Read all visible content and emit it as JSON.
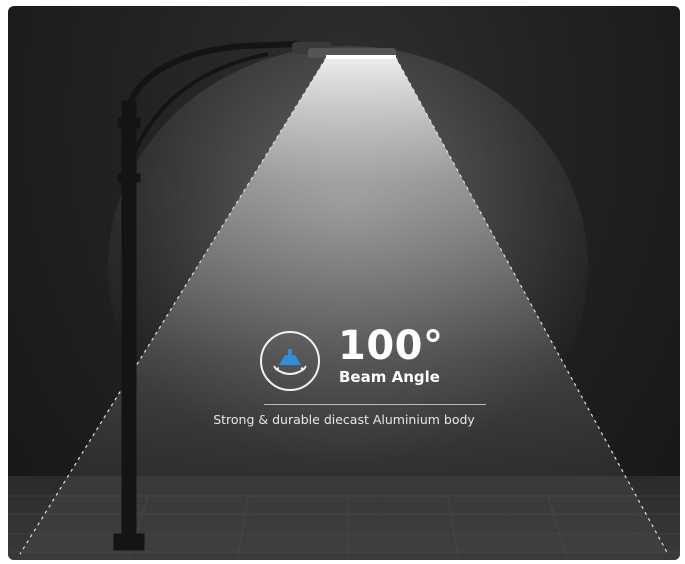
{
  "beam": {
    "angle_value": "100°",
    "angle_label": "Beam Angle",
    "caption": "Strong & durable diecast Aluminium body"
  },
  "colors": {
    "background": "#1f1f1f",
    "beam_light": "#e8e8e8",
    "accent_icon": "#2f8fd6",
    "text": "#ffffff"
  },
  "icons": {
    "beam_badge": "beam-angle-icon"
  }
}
